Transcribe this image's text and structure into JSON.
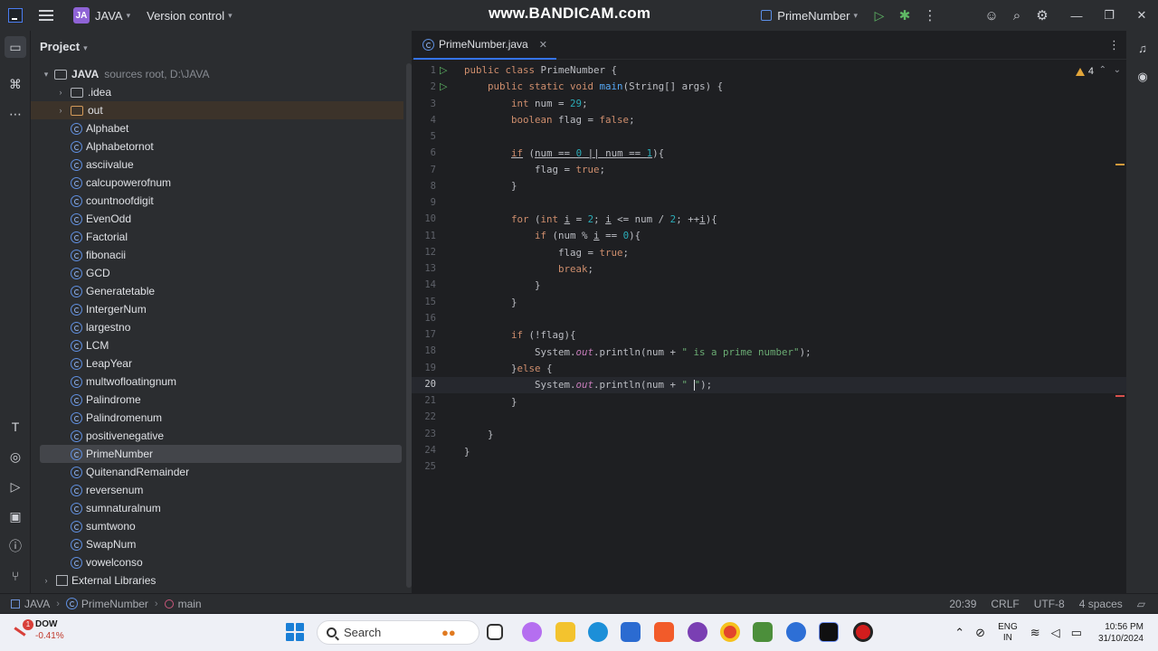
{
  "watermark": "www.BANDICAM.com",
  "titlebar": {
    "project_badge": "JA",
    "project_name": "JAVA",
    "version_control": "Version control",
    "run_config": "PrimeNumber"
  },
  "project_panel": {
    "title": "Project",
    "root": {
      "name": "JAVA",
      "meta": "sources root,  D:\\JAVA"
    },
    "folders": [
      ".idea",
      "out"
    ],
    "classes": [
      "Alphabet",
      "Alphabetornot",
      "asciivalue",
      "calcupowerofnum",
      "countnoofdigit",
      "EvenOdd",
      "Factorial",
      "fibonacii",
      "GCD",
      "Generatetable",
      "IntergerNum",
      "largestno",
      "LCM",
      "LeapYear",
      "multwofloatingnum",
      "Palindrome",
      "Palindromenum",
      "positivenegative",
      "PrimeNumber",
      "QuitenandRemainder",
      "reversenum",
      "sumnaturalnum",
      "sumtwono",
      "SwapNum",
      "vowelconso"
    ],
    "selected": "PrimeNumber",
    "external": "External Libraries"
  },
  "editor": {
    "tab_label": "PrimeNumber.java",
    "warnings": "4",
    "current_line": "20",
    "line_numbers": [
      "1",
      "2",
      "3",
      "4",
      "5",
      "6",
      "7",
      "8",
      "9",
      "10",
      "11",
      "12",
      "13",
      "14",
      "15",
      "16",
      "17",
      "18",
      "19",
      "20",
      "21",
      "22",
      "23",
      "24",
      "25"
    ]
  },
  "statusbar": {
    "crumbs": [
      "JAVA",
      "PrimeNumber",
      "main"
    ],
    "position": "20:39",
    "line_sep": "CRLF",
    "encoding": "UTF-8",
    "indent": "4 spaces"
  },
  "taskbar": {
    "stock_name": "DOW",
    "stock_change": "-0.41%",
    "stock_badge": "1",
    "search_placeholder": "Search",
    "lang_top": "ENG",
    "lang_bottom": "IN",
    "time": "10:56 PM",
    "date": "31/10/2024"
  }
}
